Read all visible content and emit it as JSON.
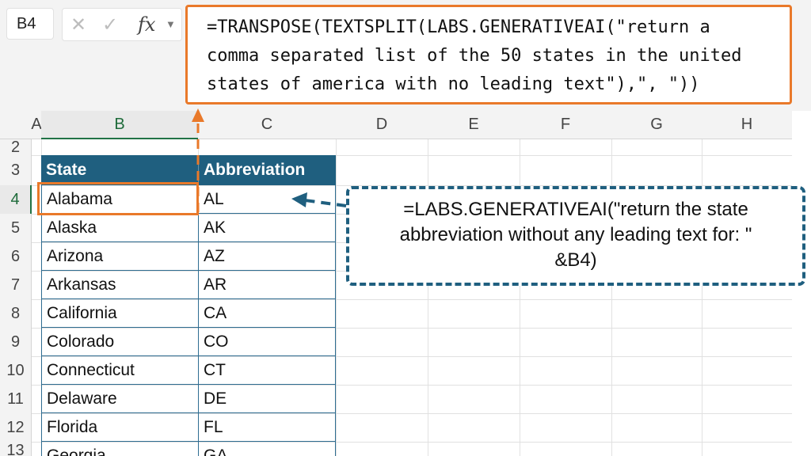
{
  "name_box": "B4",
  "formula_bar": {
    "cancel_icon": "✕",
    "enter_icon": "✓",
    "fx_label": "fx",
    "lines": [
      "=TRANSPOSE(TEXTSPLIT(LABS.GENERATIVEAI(\"return a",
      "comma separated list of the 50 states in the united",
      "states of america with no leading text\"),\", \"))"
    ]
  },
  "columns": [
    "A",
    "B",
    "C",
    "D",
    "E",
    "F",
    "G",
    "H"
  ],
  "rows": [
    "2",
    "3",
    "4",
    "5",
    "6",
    "7",
    "8",
    "9",
    "10",
    "11",
    "12",
    "13"
  ],
  "table": {
    "headers": [
      "State",
      "Abbreviation"
    ],
    "rows": [
      [
        "Alabama",
        "AL"
      ],
      [
        "Alaska",
        "AK"
      ],
      [
        "Arizona",
        "AZ"
      ],
      [
        "Arkansas",
        "AR"
      ],
      [
        "California",
        "CA"
      ],
      [
        "Colorado",
        "CO"
      ],
      [
        "Connecticut",
        "CT"
      ],
      [
        "Delaware",
        "DE"
      ],
      [
        "Florida",
        "FL"
      ],
      [
        "Georgia",
        "GA"
      ]
    ]
  },
  "callout": {
    "lines": [
      "=LABS.GENERATIVEAI(\"return the state",
      "abbreviation without any leading text for: \"",
      "&B4)"
    ]
  },
  "colors": {
    "accent_orange": "#e9792a",
    "table_header": "#1f5f7f",
    "callout_border": "#1f5f7f"
  },
  "icons": [
    "cancel-icon",
    "check-icon",
    "fx-icon",
    "chevron-down-icon",
    "arrow-left-icon",
    "arrow-up-icon"
  ]
}
